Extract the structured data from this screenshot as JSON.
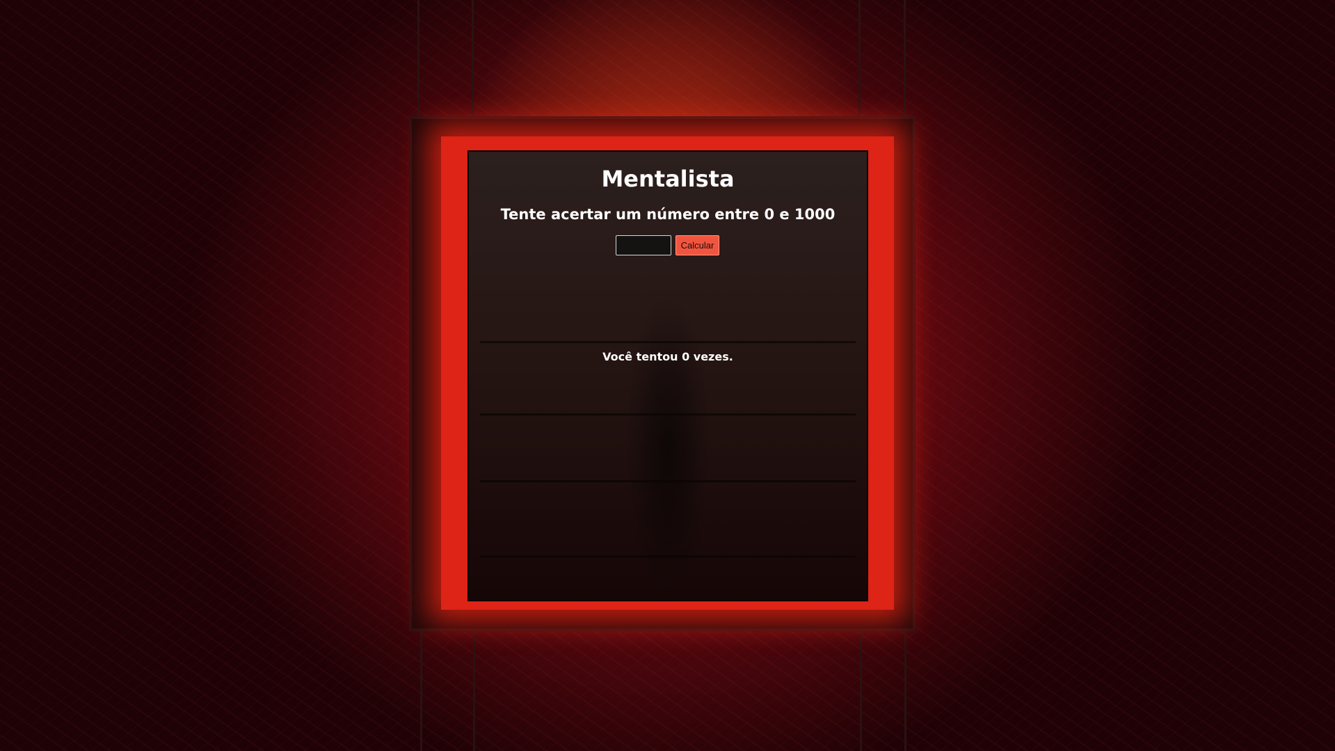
{
  "game": {
    "title": "Mentalista",
    "instruction": "Tente acertar um número entre 0 e 1000",
    "guess_input": {
      "value": "",
      "placeholder": ""
    },
    "calculate_button_label": "Calcular",
    "attempts_text": "Você tentou 0 vezes."
  },
  "colors": {
    "button": "#f2553f",
    "glow": "#ff2a1a",
    "text": "#ffffff"
  }
}
